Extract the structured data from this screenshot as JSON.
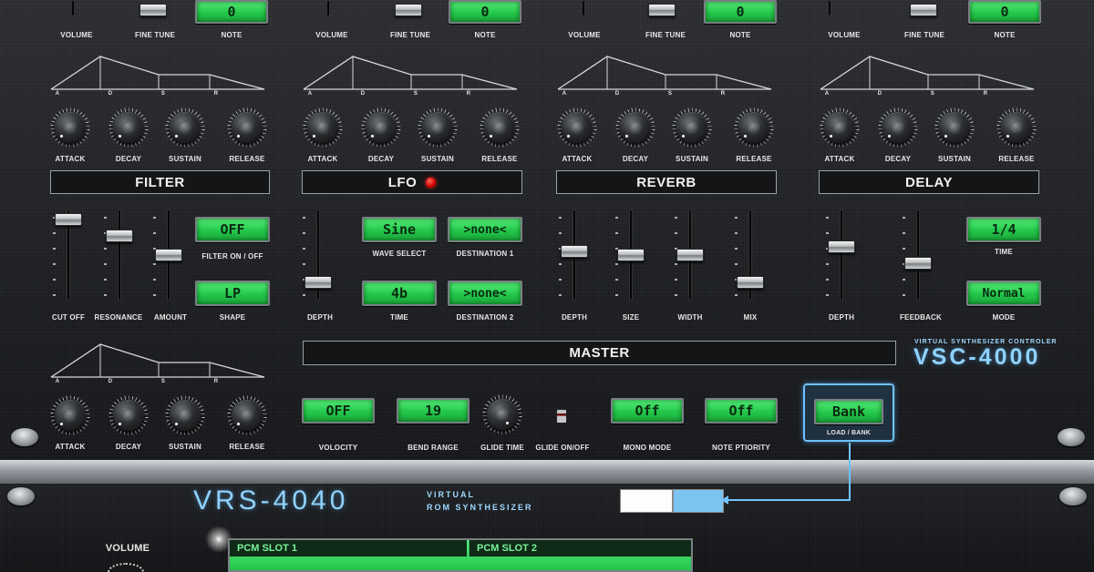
{
  "top_row": {
    "labels": [
      "VOLUME",
      "FINE TUNE",
      "NOTE"
    ],
    "note_values": [
      "0",
      "0",
      "0",
      "0"
    ]
  },
  "adsr": {
    "env_letters": [
      "A",
      "D",
      "S",
      "R"
    ],
    "knob_labels": [
      "ATTACK",
      "DECAY",
      "SUSTAIN",
      "RELEASE"
    ]
  },
  "filter": {
    "title": "FILTER",
    "on_off_value": "OFF",
    "on_off_label": "FILTER ON / OFF",
    "shape_value": "LP",
    "shape_label": "SHAPE",
    "slider_labels": [
      "CUT OFF",
      "RESONANCE",
      "AMOUNT"
    ],
    "slider_levels": [
      0.95,
      0.75,
      0.5
    ]
  },
  "lfo": {
    "title": "LFO",
    "wave_value": "Sine",
    "wave_label": "WAVE SELECT",
    "dest1_value": ">none<",
    "dest1_label": "DESTINATION 1",
    "time_value": "4b",
    "time_label": "TIME",
    "dest2_value": ">none<",
    "dest2_label": "DESTINATION 2",
    "depth_label": "DEPTH",
    "depth_level": 0.15
  },
  "reverb": {
    "title": "REVERB",
    "slider_labels": [
      "DEPTH",
      "SIZE",
      "WIDTH",
      "MIX"
    ],
    "slider_levels": [
      0.55,
      0.5,
      0.5,
      0.15
    ]
  },
  "delay": {
    "title": "DELAY",
    "time_value": "1/4",
    "time_label": "TIME",
    "mode_value": "Normal",
    "mode_label": "MODE",
    "slider_labels": [
      "DEPTH",
      "FEEDBACK"
    ],
    "slider_levels": [
      0.6,
      0.4
    ]
  },
  "master": {
    "title": "MASTER",
    "velocity_value": "OFF",
    "velocity_label": "VOLOCITY",
    "bend_value": "19",
    "bend_label": "BEND RANGE",
    "glide_time_label": "GLIDE TIME",
    "glide_onoff_label": "GLIDE ON/OFF",
    "mono_value": "Off",
    "mono_label": "MONO MODE",
    "priority_value": "Off",
    "priority_label": "NOTE PTIORITY",
    "bank_value": "Bank",
    "bank_label": "LOAD / BANK"
  },
  "brand_vsc": {
    "subtitle": "VIRTUAL SYNTHESIZER CONTROLER",
    "name": "VSC-4000"
  },
  "brand_vrs": {
    "name": "VRS-4040",
    "sub1": "VIRTUAL",
    "sub2": "ROM SYNTHESIZER"
  },
  "lower": {
    "volume_label": "VOLUME",
    "slot1": "PCM SLOT 1",
    "slot2": "PCM SLOT 2"
  },
  "colors": {
    "lcd_green": "#2fd957",
    "accent_blue": "#6fc2ff"
  }
}
